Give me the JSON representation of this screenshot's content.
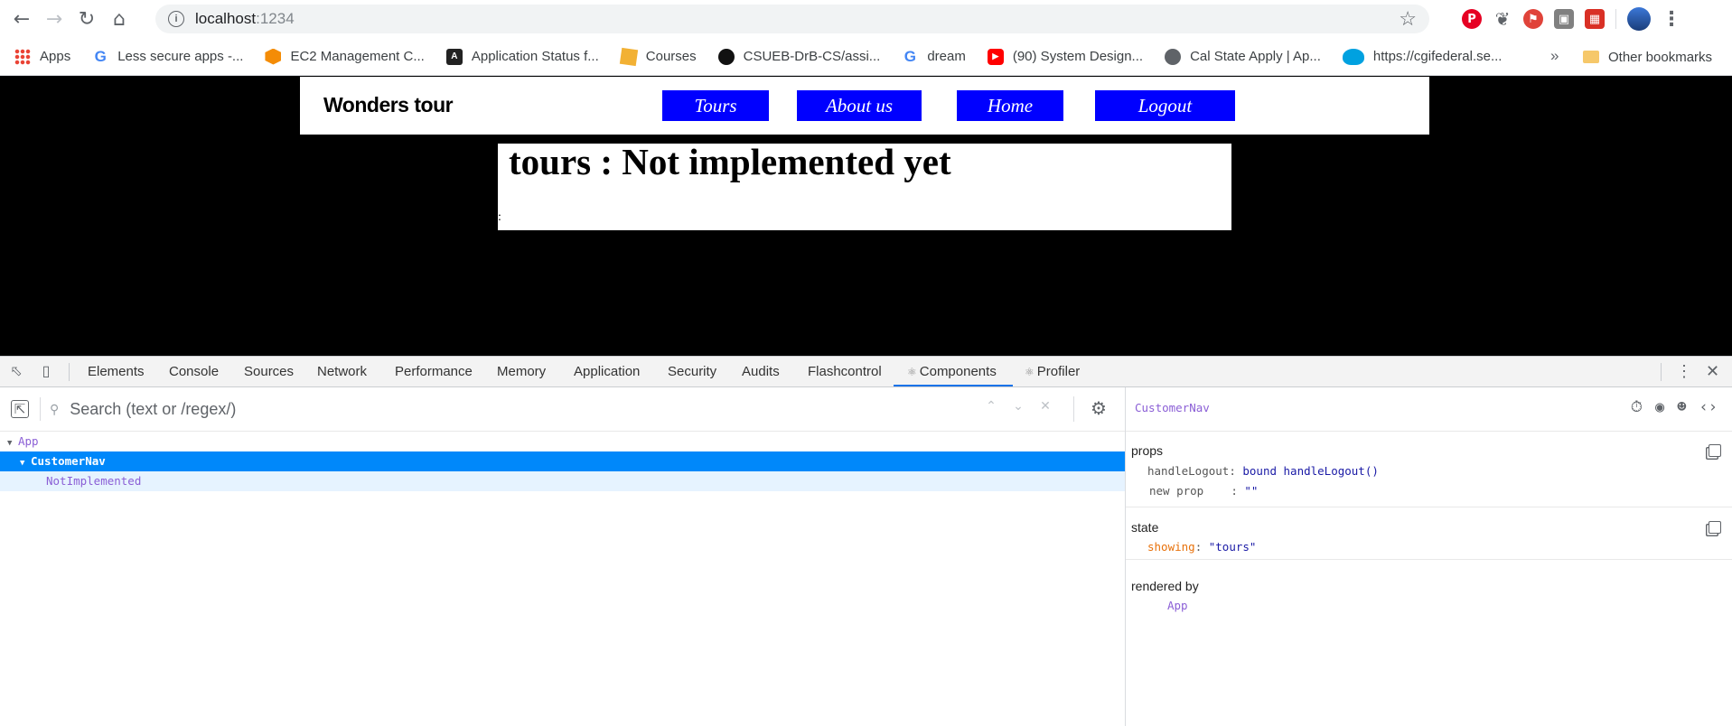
{
  "browser": {
    "url_host": "localhost",
    "url_port": ":1234",
    "bookmarks": [
      {
        "label": "Apps",
        "icon": "apps-grid-icon"
      },
      {
        "label": "Less secure apps -...",
        "icon": "google-icon"
      },
      {
        "label": "EC2 Management C...",
        "icon": "aws-icon"
      },
      {
        "label": "Application Status f...",
        "icon": "application-icon"
      },
      {
        "label": "Courses",
        "icon": "courses-icon"
      },
      {
        "label": "CSUEB-DrB-CS/assi...",
        "icon": "github-icon"
      },
      {
        "label": "dream",
        "icon": "google-icon"
      },
      {
        "label": "(90) System Design...",
        "icon": "youtube-icon"
      },
      {
        "label": "Cal State Apply | Ap...",
        "icon": "globe-icon"
      },
      {
        "label": "https://cgifederal.se...",
        "icon": "salesforce-icon"
      }
    ],
    "more_label": "»",
    "other_bookmarks": "Other bookmarks"
  },
  "site": {
    "brand": "Wonders tour",
    "nav": [
      "Tours",
      "About us",
      "Home",
      "Logout"
    ],
    "content_title": "tours : Not implemented yet",
    "content_text": ":"
  },
  "devtools": {
    "tabs": [
      "Elements",
      "Console",
      "Sources",
      "Network",
      "Performance",
      "Memory",
      "Application",
      "Security",
      "Audits",
      "Flashcontrol",
      "Components",
      "Profiler"
    ],
    "active_tab": "Components",
    "search_placeholder": "Search (text or /regex/)",
    "tree": {
      "root": "App",
      "selected": "CustomerNav",
      "child": "NotImplemented"
    },
    "inspector": {
      "component": "CustomerNav",
      "props_label": "props",
      "props": [
        {
          "key": "handleLogout",
          "value": "bound handleLogout()"
        },
        {
          "key": "new prop",
          "value": "\"\""
        }
      ],
      "state_label": "state",
      "state": [
        {
          "key": "showing",
          "value": "\"tours\""
        }
      ],
      "rendered_by_label": "rendered by",
      "rendered_by": "App"
    }
  }
}
